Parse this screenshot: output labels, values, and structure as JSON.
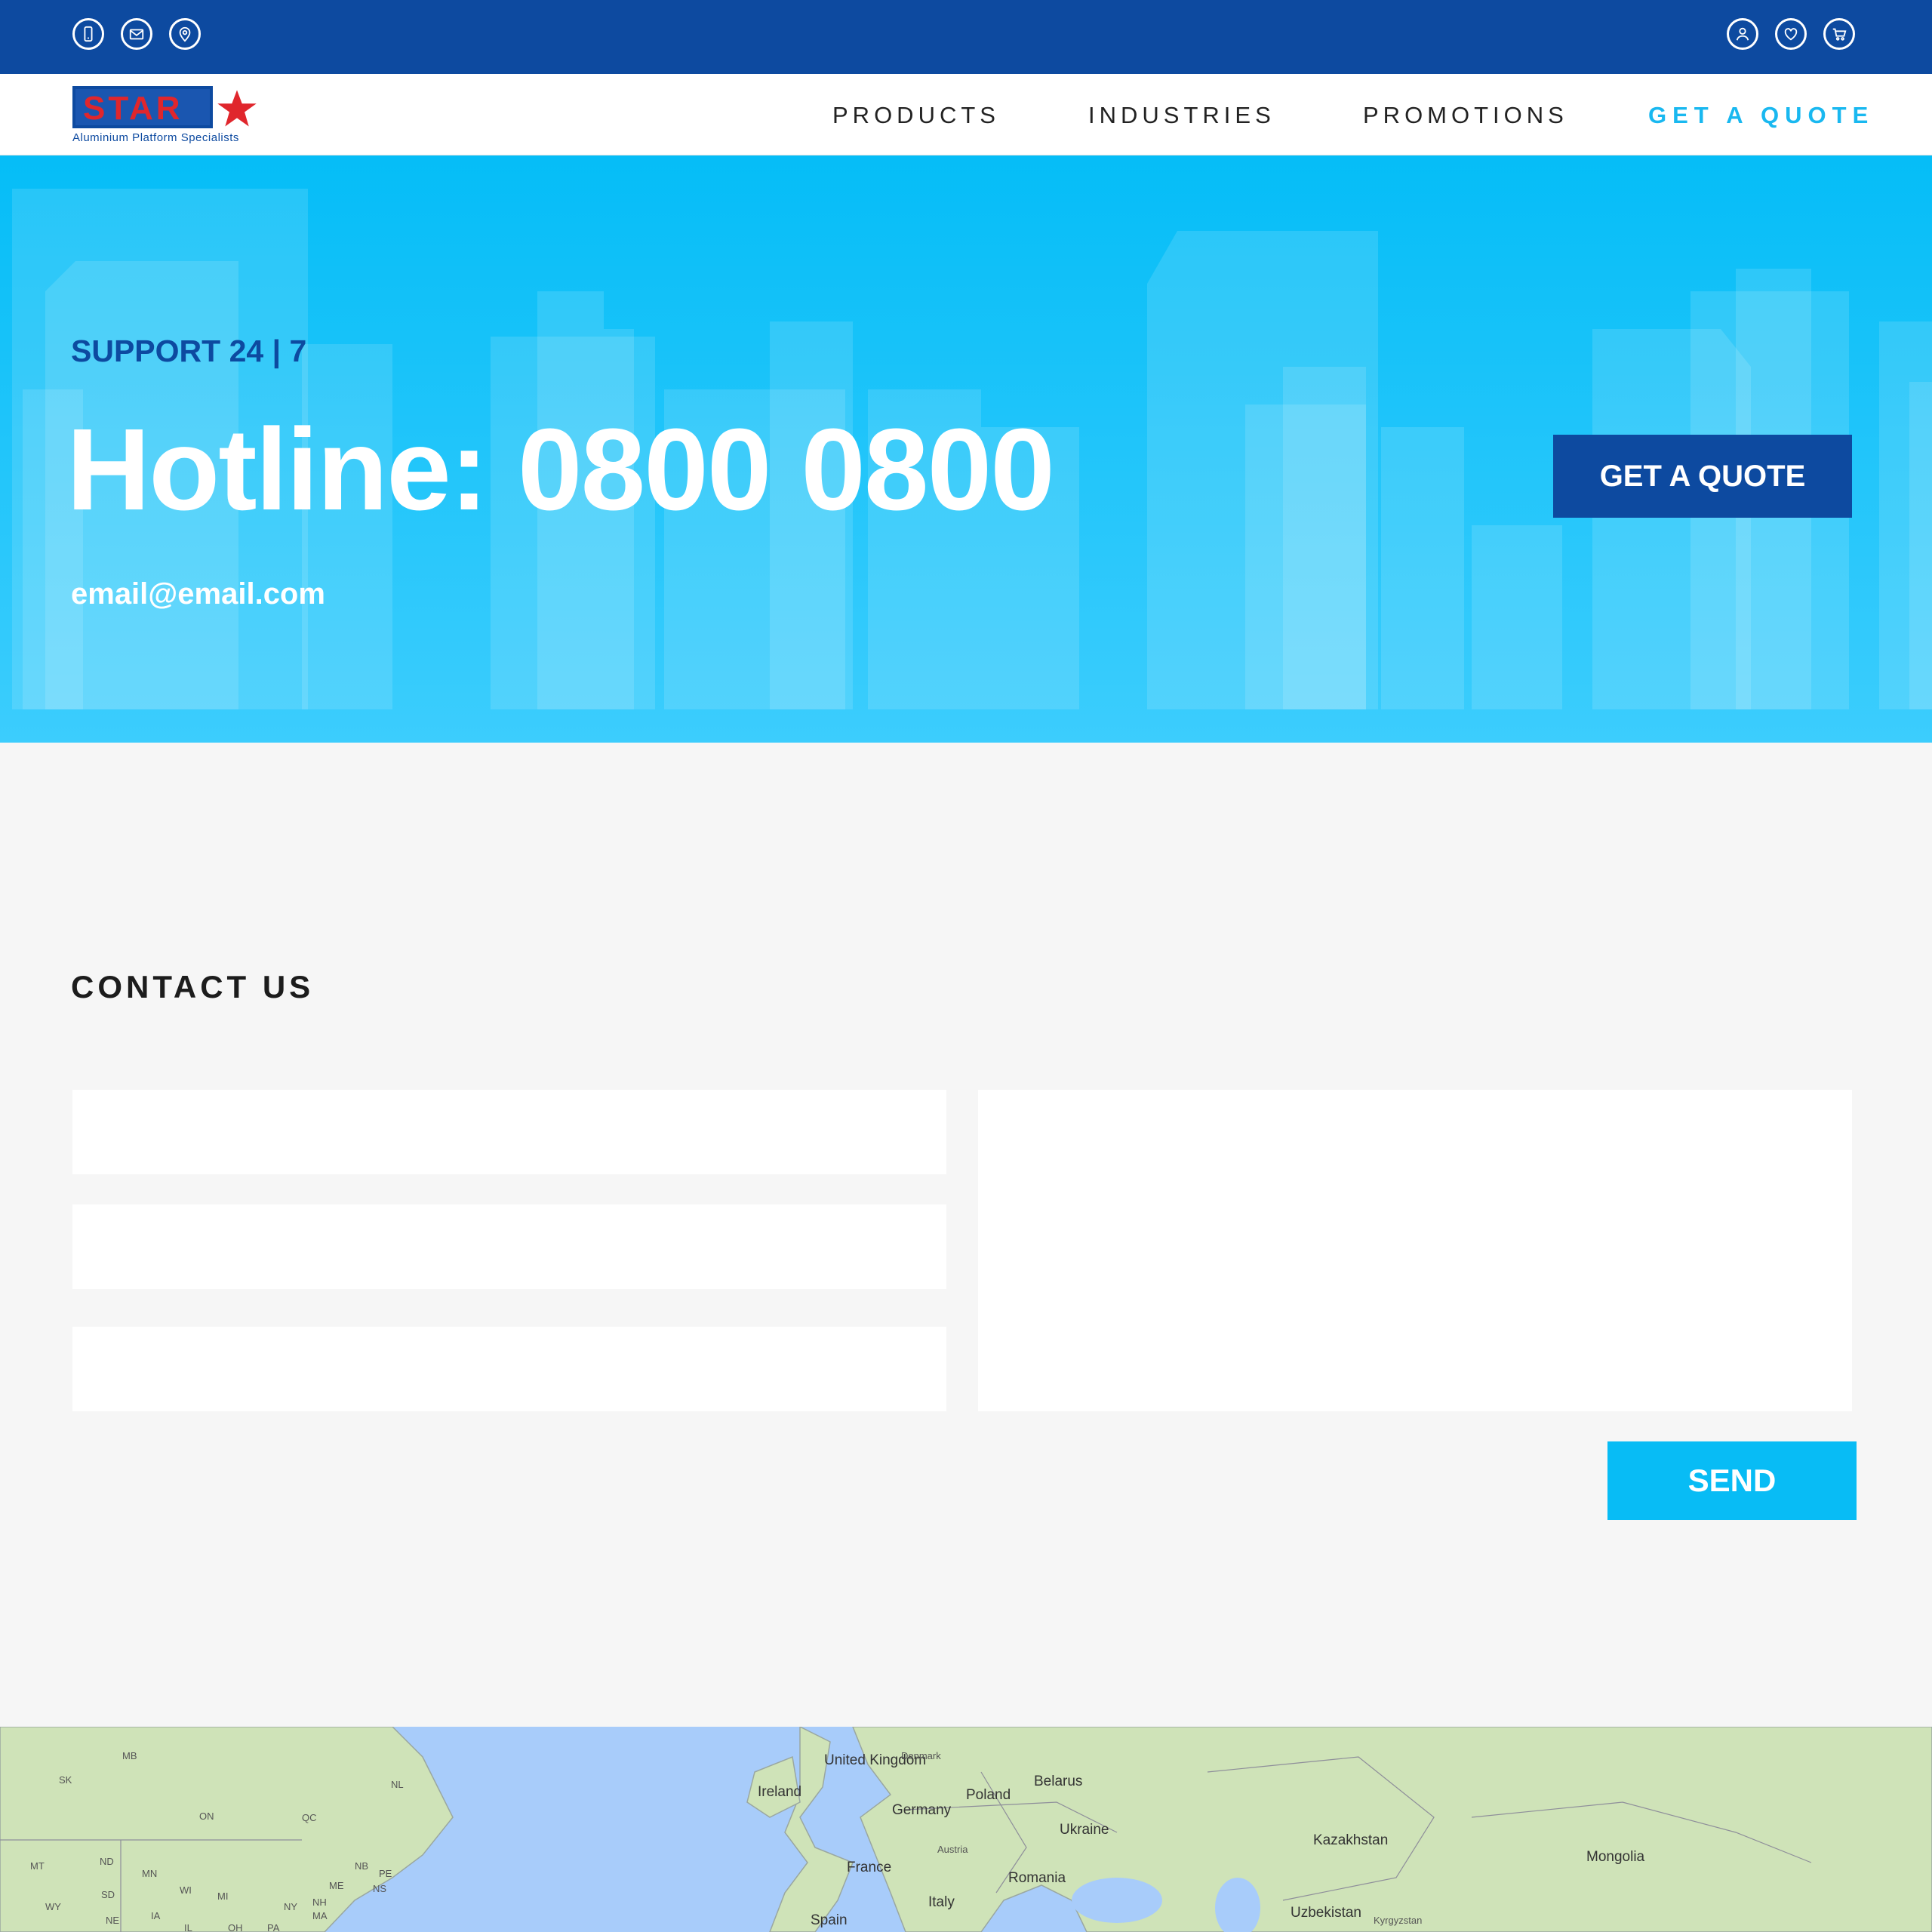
{
  "topbar": {
    "left_icons": [
      "phone-icon",
      "mail-icon",
      "location-pin-icon"
    ],
    "right_icons": [
      "user-icon",
      "heart-icon",
      "cart-icon"
    ]
  },
  "logo": {
    "wordmark": "STAR",
    "tagline": "Aluminium Platform Specialists"
  },
  "nav": {
    "items": [
      {
        "label": "PRODUCTS"
      },
      {
        "label": "INDUSTRIES"
      },
      {
        "label": "PROMOTIONS"
      },
      {
        "label": "GET A QUOTE"
      }
    ]
  },
  "hero": {
    "support": "SUPPORT 24 | 7",
    "hotline": "Hotline: 0800 0800",
    "email": "email@email.com",
    "button_label": "GET A QUOTE"
  },
  "contact": {
    "title": "CONTACT US",
    "fields": [
      {
        "placeholder": ""
      },
      {
        "placeholder": ""
      },
      {
        "placeholder": ""
      }
    ],
    "message_placeholder": "",
    "send_label": "SEND"
  },
  "map": {
    "labels": [
      "United Kingdom",
      "Ireland",
      "Denmark",
      "Belarus",
      "Poland",
      "Germany",
      "Ukraine",
      "Austria",
      "France",
      "Romania",
      "Italy",
      "Spain",
      "Kazakhstan",
      "Mongolia",
      "Uzbekistan",
      "Kyrgyzstan",
      "ON",
      "QC",
      "NL",
      "MB",
      "SK",
      "ND",
      "MN",
      "SD",
      "WI",
      "MT",
      "WY",
      "NE",
      "IA",
      "MI",
      "NY",
      "NB",
      "NS",
      "ME",
      "NH",
      "MA",
      "PE",
      "OH",
      "PA",
      "IL"
    ]
  },
  "colors": {
    "primary_dark": "#0d4aa0",
    "accent": "#08bcf5",
    "hero_top": "#05bdf7",
    "hero_bottom": "#3ccdfd",
    "logo_red": "#e0262c",
    "page_bg": "#f6f6f6"
  }
}
